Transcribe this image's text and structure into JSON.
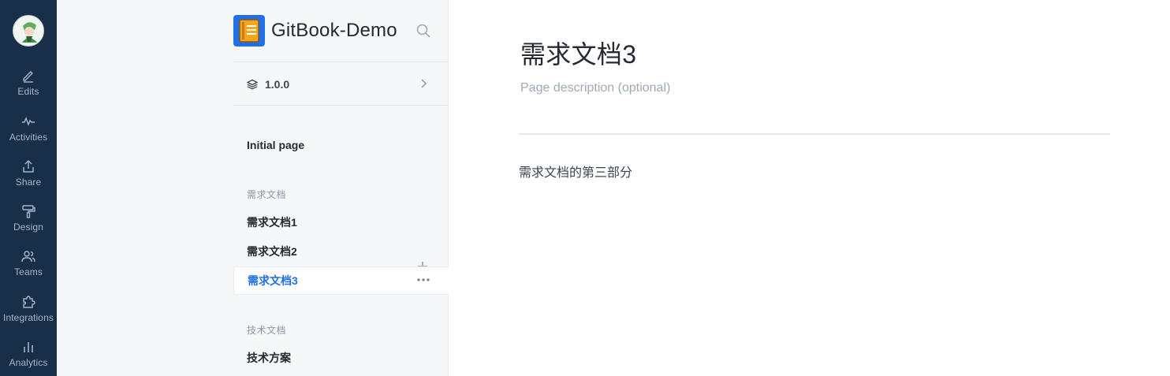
{
  "rail": {
    "items": [
      {
        "label": "Edits",
        "icon": "pencil-icon"
      },
      {
        "label": "Activities",
        "icon": "activity-icon"
      },
      {
        "label": "Share",
        "icon": "share-icon"
      },
      {
        "label": "Design",
        "icon": "paint-roller-icon"
      },
      {
        "label": "Teams",
        "icon": "users-icon"
      },
      {
        "label": "Integrations",
        "icon": "puzzle-icon"
      },
      {
        "label": "Analytics",
        "icon": "bar-chart-icon"
      }
    ]
  },
  "sidebar": {
    "title": "GitBook-Demo",
    "version": "1.0.0",
    "pages": [
      {
        "label": "Initial page"
      }
    ],
    "sections": [
      {
        "title": "需求文档",
        "items": [
          {
            "label": "需求文档1"
          },
          {
            "label": "需求文档2"
          },
          {
            "label": "需求文档3",
            "active": true
          }
        ]
      },
      {
        "title": "技术文档",
        "items": [
          {
            "label": "技术方案"
          }
        ]
      }
    ]
  },
  "main": {
    "title": "需求文档3",
    "description_placeholder": "Page description (optional)",
    "body": "需求文档的第三部分"
  },
  "colors": {
    "rail_bg": "#182f4a",
    "sidebar_bg": "#f5f7f9",
    "accent": "#1f6fe6"
  }
}
